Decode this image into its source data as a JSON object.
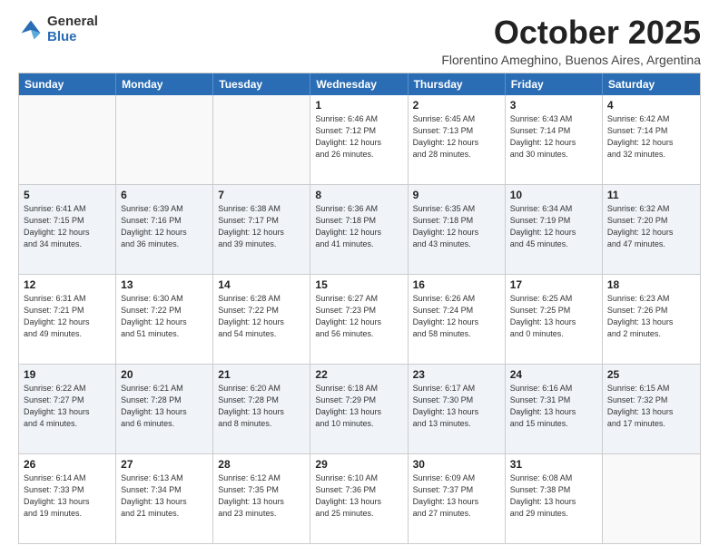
{
  "logo": {
    "general": "General",
    "blue": "Blue"
  },
  "title": "October 2025",
  "subtitle": "Florentino Ameghino, Buenos Aires, Argentina",
  "day_headers": [
    "Sunday",
    "Monday",
    "Tuesday",
    "Wednesday",
    "Thursday",
    "Friday",
    "Saturday"
  ],
  "weeks": [
    [
      {
        "day": "",
        "info": ""
      },
      {
        "day": "",
        "info": ""
      },
      {
        "day": "",
        "info": ""
      },
      {
        "day": "1",
        "info": "Sunrise: 6:46 AM\nSunset: 7:12 PM\nDaylight: 12 hours\nand 26 minutes."
      },
      {
        "day": "2",
        "info": "Sunrise: 6:45 AM\nSunset: 7:13 PM\nDaylight: 12 hours\nand 28 minutes."
      },
      {
        "day": "3",
        "info": "Sunrise: 6:43 AM\nSunset: 7:14 PM\nDaylight: 12 hours\nand 30 minutes."
      },
      {
        "day": "4",
        "info": "Sunrise: 6:42 AM\nSunset: 7:14 PM\nDaylight: 12 hours\nand 32 minutes."
      }
    ],
    [
      {
        "day": "5",
        "info": "Sunrise: 6:41 AM\nSunset: 7:15 PM\nDaylight: 12 hours\nand 34 minutes."
      },
      {
        "day": "6",
        "info": "Sunrise: 6:39 AM\nSunset: 7:16 PM\nDaylight: 12 hours\nand 36 minutes."
      },
      {
        "day": "7",
        "info": "Sunrise: 6:38 AM\nSunset: 7:17 PM\nDaylight: 12 hours\nand 39 minutes."
      },
      {
        "day": "8",
        "info": "Sunrise: 6:36 AM\nSunset: 7:18 PM\nDaylight: 12 hours\nand 41 minutes."
      },
      {
        "day": "9",
        "info": "Sunrise: 6:35 AM\nSunset: 7:18 PM\nDaylight: 12 hours\nand 43 minutes."
      },
      {
        "day": "10",
        "info": "Sunrise: 6:34 AM\nSunset: 7:19 PM\nDaylight: 12 hours\nand 45 minutes."
      },
      {
        "day": "11",
        "info": "Sunrise: 6:32 AM\nSunset: 7:20 PM\nDaylight: 12 hours\nand 47 minutes."
      }
    ],
    [
      {
        "day": "12",
        "info": "Sunrise: 6:31 AM\nSunset: 7:21 PM\nDaylight: 12 hours\nand 49 minutes."
      },
      {
        "day": "13",
        "info": "Sunrise: 6:30 AM\nSunset: 7:22 PM\nDaylight: 12 hours\nand 51 minutes."
      },
      {
        "day": "14",
        "info": "Sunrise: 6:28 AM\nSunset: 7:22 PM\nDaylight: 12 hours\nand 54 minutes."
      },
      {
        "day": "15",
        "info": "Sunrise: 6:27 AM\nSunset: 7:23 PM\nDaylight: 12 hours\nand 56 minutes."
      },
      {
        "day": "16",
        "info": "Sunrise: 6:26 AM\nSunset: 7:24 PM\nDaylight: 12 hours\nand 58 minutes."
      },
      {
        "day": "17",
        "info": "Sunrise: 6:25 AM\nSunset: 7:25 PM\nDaylight: 13 hours\nand 0 minutes."
      },
      {
        "day": "18",
        "info": "Sunrise: 6:23 AM\nSunset: 7:26 PM\nDaylight: 13 hours\nand 2 minutes."
      }
    ],
    [
      {
        "day": "19",
        "info": "Sunrise: 6:22 AM\nSunset: 7:27 PM\nDaylight: 13 hours\nand 4 minutes."
      },
      {
        "day": "20",
        "info": "Sunrise: 6:21 AM\nSunset: 7:28 PM\nDaylight: 13 hours\nand 6 minutes."
      },
      {
        "day": "21",
        "info": "Sunrise: 6:20 AM\nSunset: 7:28 PM\nDaylight: 13 hours\nand 8 minutes."
      },
      {
        "day": "22",
        "info": "Sunrise: 6:18 AM\nSunset: 7:29 PM\nDaylight: 13 hours\nand 10 minutes."
      },
      {
        "day": "23",
        "info": "Sunrise: 6:17 AM\nSunset: 7:30 PM\nDaylight: 13 hours\nand 13 minutes."
      },
      {
        "day": "24",
        "info": "Sunrise: 6:16 AM\nSunset: 7:31 PM\nDaylight: 13 hours\nand 15 minutes."
      },
      {
        "day": "25",
        "info": "Sunrise: 6:15 AM\nSunset: 7:32 PM\nDaylight: 13 hours\nand 17 minutes."
      }
    ],
    [
      {
        "day": "26",
        "info": "Sunrise: 6:14 AM\nSunset: 7:33 PM\nDaylight: 13 hours\nand 19 minutes."
      },
      {
        "day": "27",
        "info": "Sunrise: 6:13 AM\nSunset: 7:34 PM\nDaylight: 13 hours\nand 21 minutes."
      },
      {
        "day": "28",
        "info": "Sunrise: 6:12 AM\nSunset: 7:35 PM\nDaylight: 13 hours\nand 23 minutes."
      },
      {
        "day": "29",
        "info": "Sunrise: 6:10 AM\nSunset: 7:36 PM\nDaylight: 13 hours\nand 25 minutes."
      },
      {
        "day": "30",
        "info": "Sunrise: 6:09 AM\nSunset: 7:37 PM\nDaylight: 13 hours\nand 27 minutes."
      },
      {
        "day": "31",
        "info": "Sunrise: 6:08 AM\nSunset: 7:38 PM\nDaylight: 13 hours\nand 29 minutes."
      },
      {
        "day": "",
        "info": ""
      }
    ]
  ]
}
